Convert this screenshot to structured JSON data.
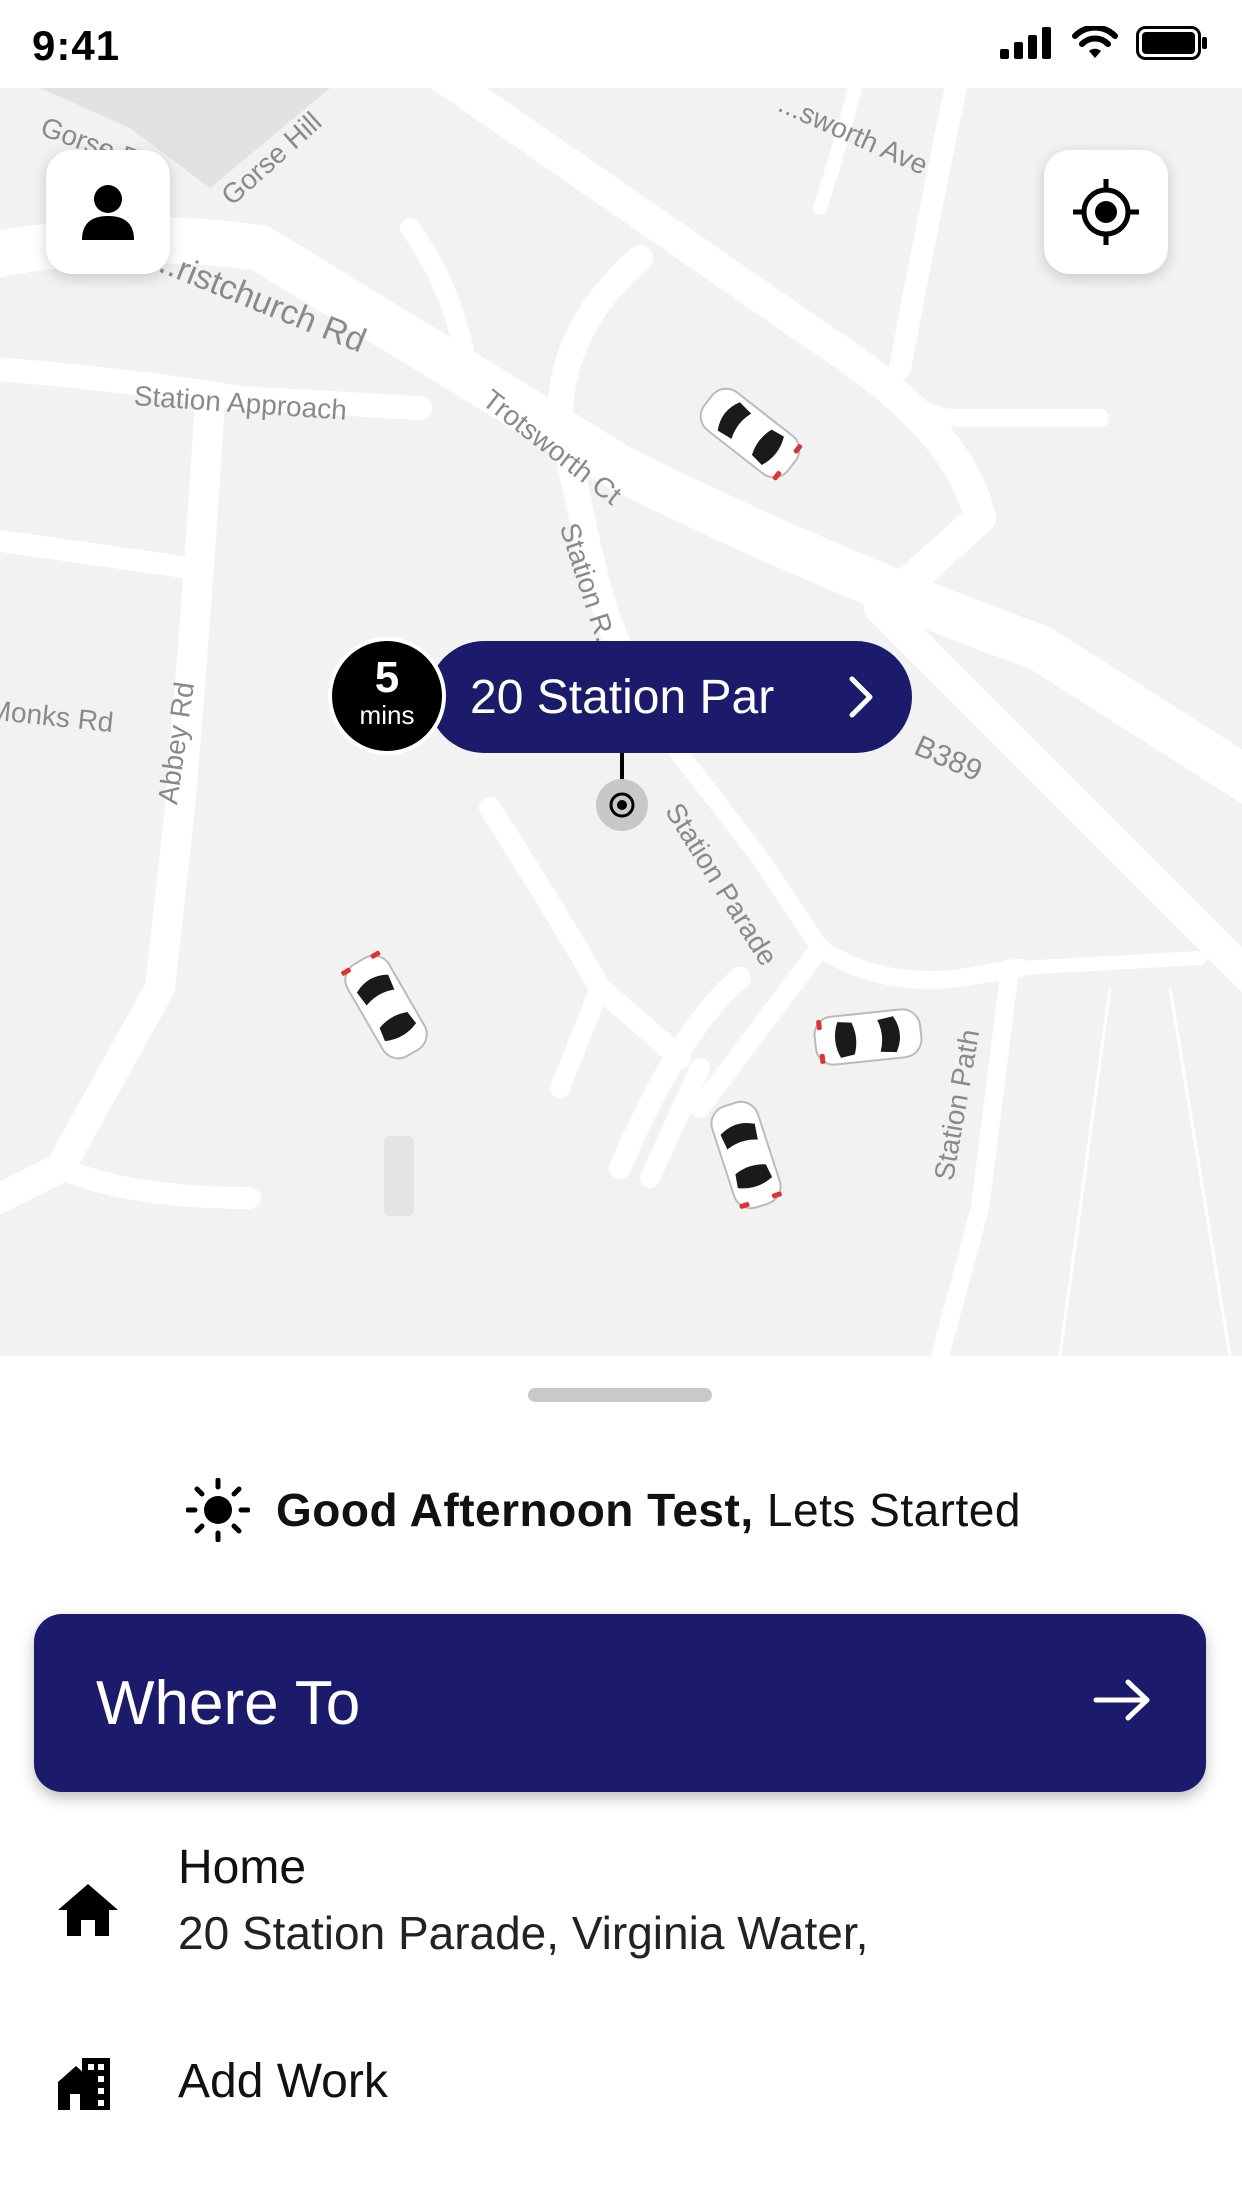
{
  "status_bar": {
    "time": "9:41"
  },
  "map": {
    "road_labels": [
      "Gorse Rd",
      "Gorse Hill",
      "...sworth Ave",
      "...ristchurch Rd",
      "Station Approach",
      "Trotsworth Ct",
      "Station R...",
      "Monks Rd",
      "Abbey Rd",
      "B389",
      "Station Parade",
      "Station Path"
    ],
    "pickup": {
      "eta_value": "5",
      "eta_unit": "mins",
      "address": "20 Station Par"
    }
  },
  "sheet": {
    "greeting_bold": "Good Afternoon Test,",
    "greeting_rest": "Lets Started",
    "where_to_label": "Where To",
    "saved_places": [
      {
        "title": "Home",
        "subtitle": "20 Station Parade, Virginia Water,",
        "icon": "home-icon"
      },
      {
        "title": "Add Work",
        "subtitle": "",
        "icon": "building-icon"
      }
    ]
  },
  "colors": {
    "primary": "#1b1a6b",
    "map_background": "#f2f2f2",
    "road": "#ffffff",
    "label": "#8a8a8a"
  }
}
